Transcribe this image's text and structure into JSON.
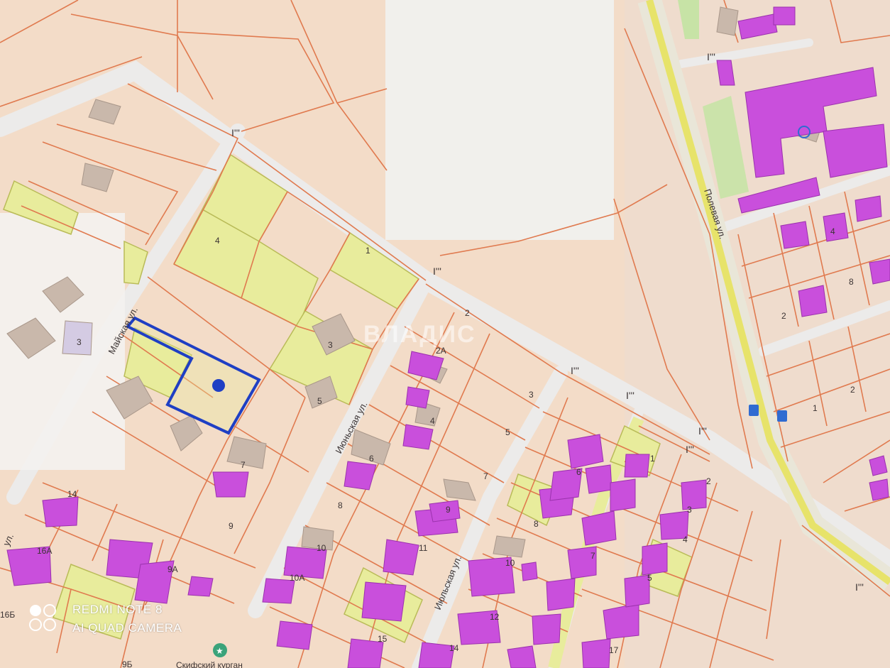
{
  "map": {
    "street_labels": {
      "mayskaya": "Майская ул.",
      "iyunskaya": "Июньская ул.",
      "iyulskaya": "Июльская ул.",
      "polevaya": "Полевая ул.",
      "edge_left": "ул."
    },
    "poi": {
      "kurgan": "Скифский курган"
    },
    "plot_labels": [
      "1",
      "2",
      "2А",
      "3",
      "3",
      "3",
      "4",
      "4",
      "5",
      "5",
      "6",
      "7",
      "7",
      "8",
      "8",
      "9",
      "9",
      "9А",
      "10",
      "10",
      "10А",
      "11",
      "12",
      "14",
      "14",
      "16А",
      "16Б",
      "9Б",
      "1",
      "2",
      "3",
      "4",
      "5",
      "6",
      "7",
      "8",
      "2",
      "4",
      "1",
      "2",
      "15",
      "17"
    ],
    "selected_plot": "blue outline with marker"
  },
  "brand_watermark": "ВЛАДИС",
  "camera_watermark": {
    "line1": "REDMI NOTE 8",
    "line2": "AI QUAD CAMERA"
  },
  "colors": {
    "background": "#f3dcc8",
    "road": "#ecebea",
    "boundary": "#e07a4f",
    "plot_yellow": "#e8ec9c",
    "building": "#c94fdc",
    "selected": "#1f3fc4",
    "polevaya_road": "#e7e36a"
  }
}
